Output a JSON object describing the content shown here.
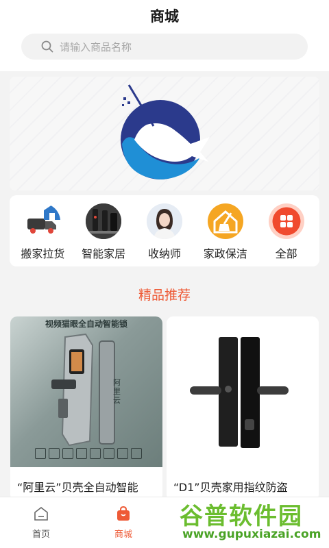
{
  "header": {
    "title": "商城"
  },
  "search": {
    "placeholder": "请输入商品名称"
  },
  "categories": [
    {
      "label": "搬家拉货",
      "icon": "moving-truck-icon"
    },
    {
      "label": "智能家居",
      "icon": "smart-lock-image"
    },
    {
      "label": "收纳师",
      "icon": "organizer-avatar"
    },
    {
      "label": "家政保洁",
      "icon": "cleaning-broom-icon"
    },
    {
      "label": "全部",
      "icon": "all-grid-icon"
    }
  ],
  "section": {
    "title": "精品推荐"
  },
  "products": [
    {
      "name": "“阿里云”贝壳全自动智能",
      "image_heading": "视频猫眼全自动智能锁",
      "image_side_text": "阿里云"
    },
    {
      "name": "“D1”贝壳家用指纹防盗"
    }
  ],
  "tabbar": [
    {
      "label": "首页",
      "icon": "home-icon",
      "active": false
    },
    {
      "label": "商城",
      "icon": "shopping-bag-icon",
      "active": true
    }
  ],
  "watermark": {
    "line1": "谷普软件园",
    "line2": "www.gupuxiazai.com"
  },
  "colors": {
    "accent": "#ee5a36",
    "logo_blue": "#2b3a8c",
    "logo_cyan": "#1f8fd6"
  }
}
